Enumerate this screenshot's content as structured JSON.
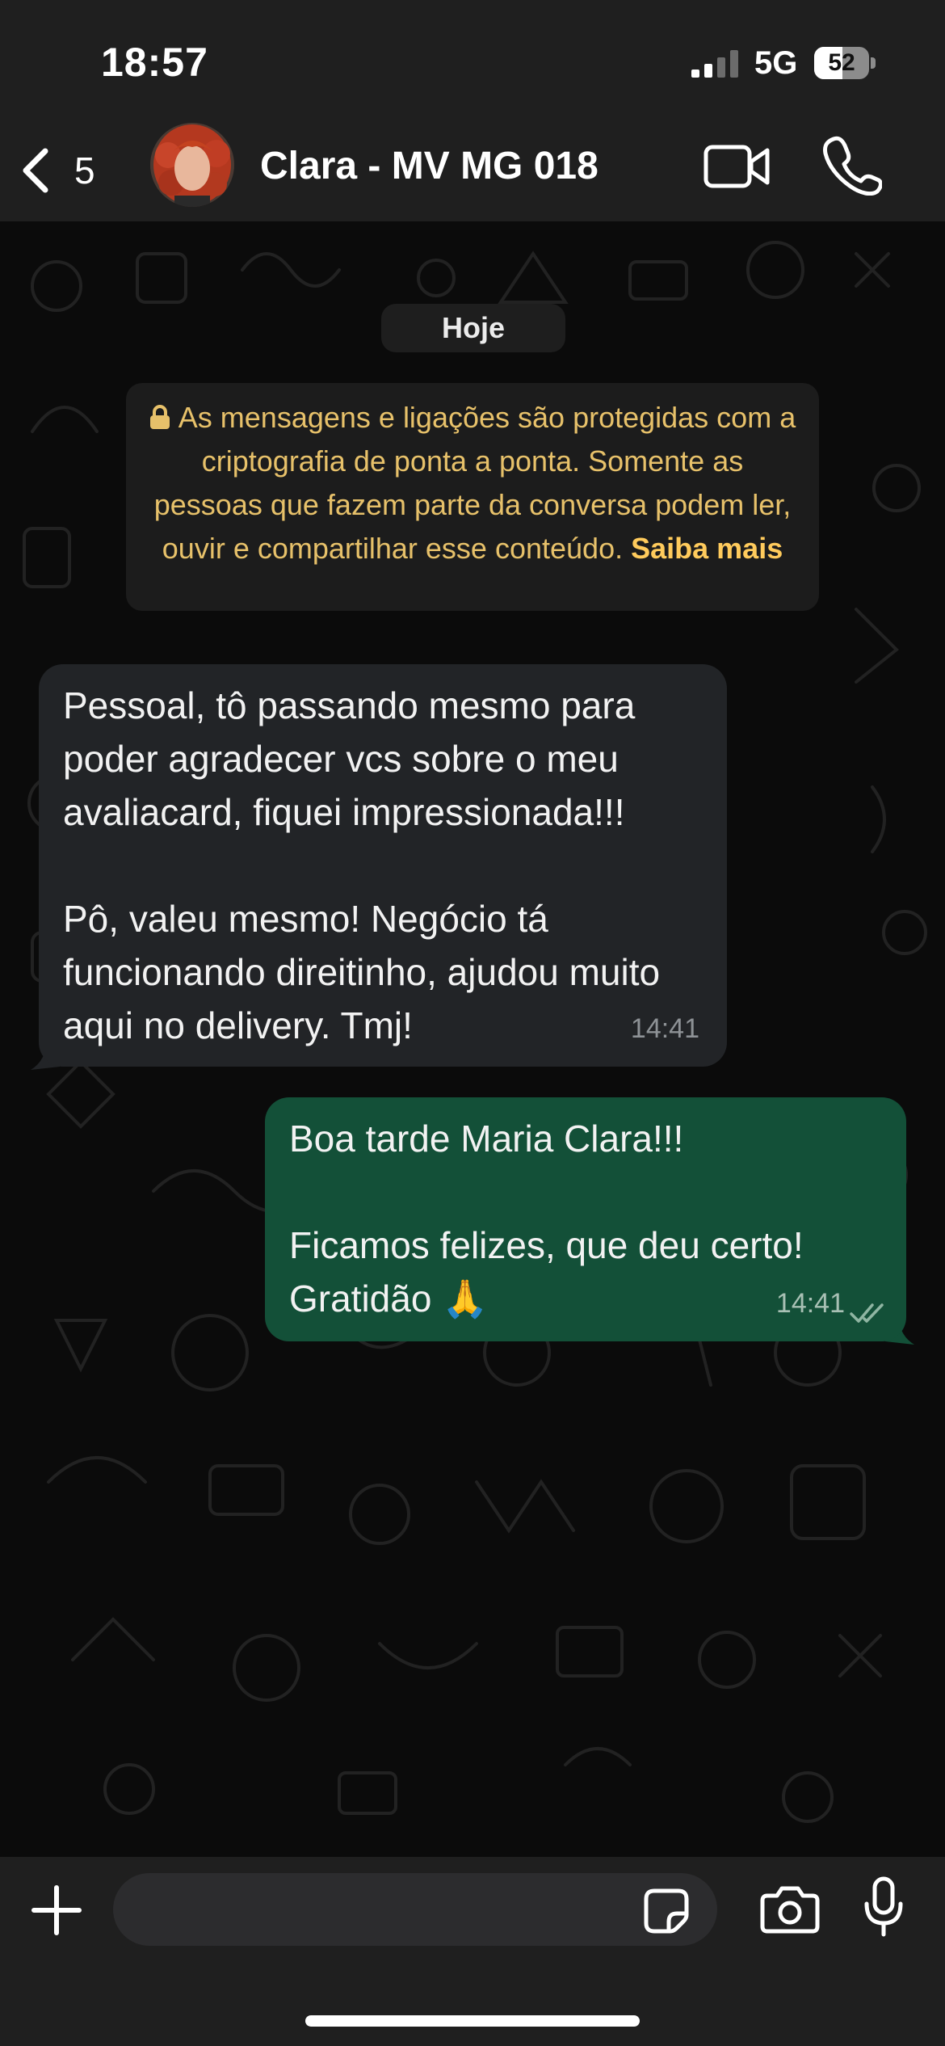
{
  "status_bar": {
    "time": "18:57",
    "network": "5G",
    "battery_percent": 52,
    "battery_label": "52",
    "signal_bars_active": 2,
    "signal_bars_total": 4
  },
  "header": {
    "back_count": "5",
    "contact_name": "Clara - MV MG 018",
    "icons": [
      "chevron-left-icon",
      "video-camera-icon",
      "phone-icon"
    ]
  },
  "chat": {
    "date_chip": "Hoje",
    "encryption_notice": {
      "text": "As mensagens e ligações são protegidas com a criptografia de ponta a ponta. Somente as pessoas que fazem parte da conversa podem ler, ouvir e compartilhar esse conteúdo.",
      "link": "Saiba mais"
    },
    "messages": [
      {
        "direction": "incoming",
        "paragraph_1": "Pessoal, tô passando mesmo para poder agradecer vcs sobre o meu avaliacard, fiquei impressionada!!!",
        "paragraph_2": "Pô, valeu mesmo! Negócio tá funcionando direitinho, ajudou muito aqui no delivery. Tmj!",
        "time": "14:41"
      },
      {
        "direction": "outgoing",
        "paragraph_1": "Boa tarde Maria Clara!!!",
        "paragraph_2": "Ficamos felizes, que deu certo! Gratidão 🙏",
        "time": "14:41",
        "status": "read-double-check"
      }
    ]
  },
  "input_bar": {
    "placeholder": "",
    "icons": [
      "plus-icon",
      "sticker-icon",
      "camera-icon",
      "microphone-icon"
    ]
  },
  "colors": {
    "bar_background": "#1f1f1f",
    "chat_background": "#0b0b0b",
    "incoming_bubble": "#222427",
    "outgoing_bubble": "#135038",
    "encryption_text": "#e7c16a"
  }
}
